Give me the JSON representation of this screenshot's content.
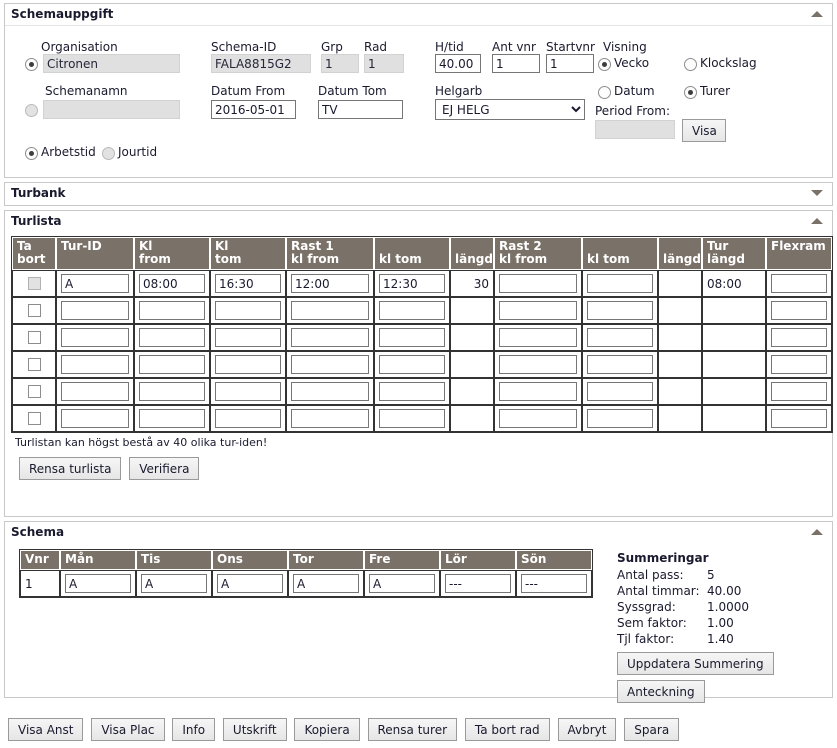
{
  "panels": {
    "schemauppgift": {
      "title": "Schemauppgift",
      "toggle_icon": "triangle-up-icon"
    },
    "turbank": {
      "title": "Turbank",
      "toggle_icon": "triangle-down-icon"
    },
    "turlista": {
      "title": "Turlista",
      "toggle_icon": "triangle-up-icon"
    },
    "schema": {
      "title": "Schema",
      "toggle_icon": "triangle-up-icon"
    }
  },
  "schemauppgift": {
    "organisation_label": "Organisation",
    "organisation_value": "Citronen",
    "organisation_radio_checked": true,
    "schemanamn_label": "Schemanamn",
    "schemanamn_value": "",
    "schemanamn_radio_checked": false,
    "schema_id_label": "Schema-ID",
    "schema_id_value": "FALA8815G2",
    "grp_label": "Grp",
    "grp_value": "1",
    "rad_label": "Rad",
    "rad_value": "1",
    "datum_from_label": "Datum From",
    "datum_from_value": "2016-05-01",
    "datum_tom_label": "Datum Tom",
    "datum_tom_value": "TV",
    "htid_label": "H/tid",
    "htid_value": "40.00",
    "ant_vnr_label": "Ant vnr",
    "ant_vnr_value": "1",
    "startvnr_label": "Startvnr",
    "startvnr_value": "1",
    "helgarb_label": "Helgarb",
    "helgarb_value": "EJ HELG",
    "helgarb_options": [
      "EJ HELG"
    ],
    "visning_label": "Visning",
    "visning_options": [
      {
        "label": "Vecko",
        "checked": true
      },
      {
        "label": "Klockslag",
        "checked": false
      },
      {
        "label": "Datum",
        "checked": false
      },
      {
        "label": "Turer",
        "checked": true
      }
    ],
    "period_from_label": "Period From:",
    "period_from_value": "",
    "visa_button": "Visa",
    "tidtyp_options": [
      {
        "label": "Arbetstid",
        "checked": true
      },
      {
        "label": "Jourtid",
        "checked": false
      }
    ]
  },
  "turlista": {
    "columns": [
      "Ta bort",
      "Tur-ID",
      "Kl from",
      "Kl tom",
      "Rast 1 kl from",
      "kl tom",
      "längd",
      "Rast 2 kl from",
      "kl tom",
      "längd",
      "Tur längd",
      "Flexram"
    ],
    "columns_display": [
      [
        "Ta",
        "bort"
      ],
      [
        "Tur-ID",
        ""
      ],
      [
        "Kl",
        "from"
      ],
      [
        "Kl",
        "tom"
      ],
      [
        "Rast 1",
        "kl from"
      ],
      [
        "kl tom",
        ""
      ],
      [
        "längd",
        ""
      ],
      [
        "Rast 2",
        "kl from"
      ],
      [
        "kl tom",
        ""
      ],
      [
        "längd",
        ""
      ],
      [
        "Tur",
        "längd"
      ],
      [
        "Flexram",
        ""
      ]
    ],
    "rows": [
      {
        "ta_bort_checked": false,
        "ta_bort_disabled": true,
        "tur_id": "A",
        "kl_from": "08:00",
        "kl_tom": "16:30",
        "rast1_from": "12:00",
        "rast1_tom": "12:30",
        "rast1_langd": "30",
        "rast2_from": "",
        "rast2_tom": "",
        "rast2_langd": "",
        "tur_langd": "08:00",
        "flexram": ""
      },
      {
        "ta_bort_checked": false,
        "ta_bort_disabled": false,
        "tur_id": "",
        "kl_from": "",
        "kl_tom": "",
        "rast1_from": "",
        "rast1_tom": "",
        "rast1_langd": "",
        "rast2_from": "",
        "rast2_tom": "",
        "rast2_langd": "",
        "tur_langd": "",
        "flexram": ""
      },
      {
        "ta_bort_checked": false,
        "ta_bort_disabled": false,
        "tur_id": "",
        "kl_from": "",
        "kl_tom": "",
        "rast1_from": "",
        "rast1_tom": "",
        "rast1_langd": "",
        "rast2_from": "",
        "rast2_tom": "",
        "rast2_langd": "",
        "tur_langd": "",
        "flexram": ""
      },
      {
        "ta_bort_checked": false,
        "ta_bort_disabled": false,
        "tur_id": "",
        "kl_from": "",
        "kl_tom": "",
        "rast1_from": "",
        "rast1_tom": "",
        "rast1_langd": "",
        "rast2_from": "",
        "rast2_tom": "",
        "rast2_langd": "",
        "tur_langd": "",
        "flexram": ""
      },
      {
        "ta_bort_checked": false,
        "ta_bort_disabled": false,
        "tur_id": "",
        "kl_from": "",
        "kl_tom": "",
        "rast1_from": "",
        "rast1_tom": "",
        "rast1_langd": "",
        "rast2_from": "",
        "rast2_tom": "",
        "rast2_langd": "",
        "tur_langd": "",
        "flexram": ""
      },
      {
        "ta_bort_checked": false,
        "ta_bort_disabled": false,
        "tur_id": "",
        "kl_from": "",
        "kl_tom": "",
        "rast1_from": "",
        "rast1_tom": "",
        "rast1_langd": "",
        "rast2_from": "",
        "rast2_tom": "",
        "rast2_langd": "",
        "tur_langd": "",
        "flexram": ""
      }
    ],
    "hint": "Turlistan kan högst bestå av 40 olika tur-iden!",
    "buttons": [
      "Rensa turlista",
      "Verifiera"
    ]
  },
  "schema": {
    "columns": [
      "Vnr",
      "Mån",
      "Tis",
      "Ons",
      "Tor",
      "Fre",
      "Lör",
      "Sön"
    ],
    "rows": [
      {
        "vnr": "1",
        "days": [
          "A",
          "A",
          "A",
          "A",
          "A",
          "---",
          "---"
        ]
      }
    ],
    "summary": {
      "title": "Summeringar",
      "items": [
        {
          "key": "Antal pass:",
          "value": "5"
        },
        {
          "key": "Antal timmar:",
          "value": "40.00"
        },
        {
          "key": "Syssgrad:",
          "value": "1.0000"
        },
        {
          "key": "Sem faktor:",
          "value": "1.00"
        },
        {
          "key": "Tjl faktor:",
          "value": "1.40"
        }
      ],
      "update_button": "Uppdatera Summering",
      "note_button": "Anteckning"
    }
  },
  "bottom_buttons": [
    "Visa Anst",
    "Visa Plac",
    "Info",
    "Utskrift",
    "Kopiera",
    "Rensa turer",
    "Ta bort rad",
    "Avbryt",
    "Spara"
  ]
}
